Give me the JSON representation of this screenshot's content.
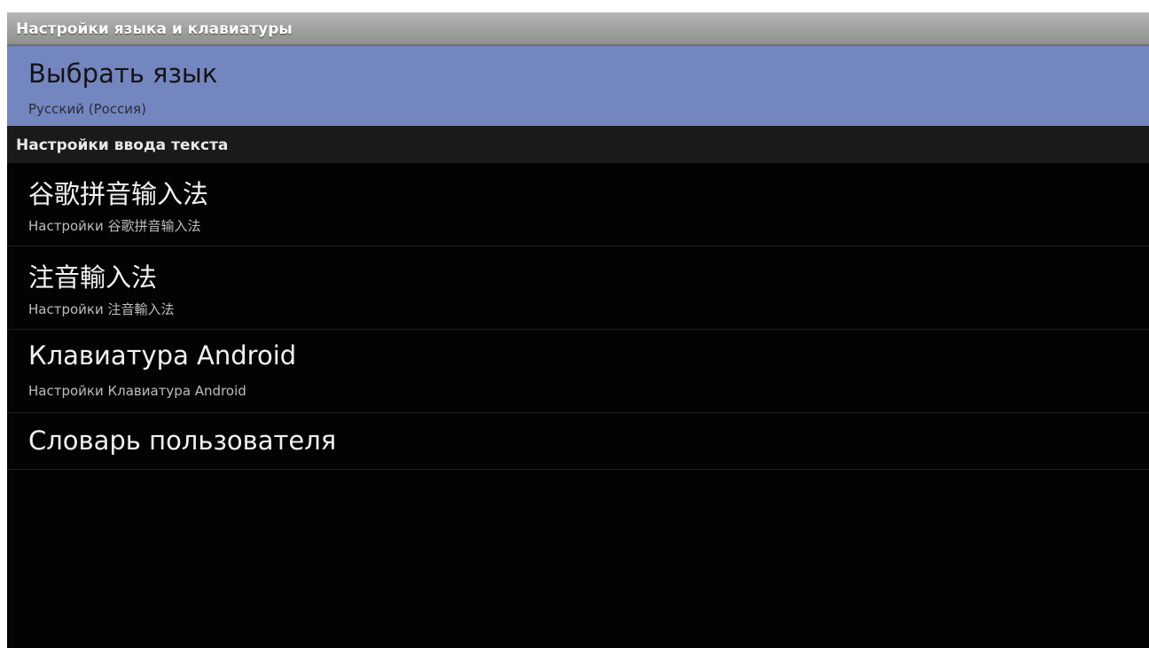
{
  "screen": {
    "title": "Настройки языка и клавиатуры"
  },
  "language": {
    "title": "Выбрать язык",
    "summary": "Русский (Россия)"
  },
  "input_category": {
    "label": "Настройки ввода текста"
  },
  "input_methods": [
    {
      "title": "谷歌拼音输入法",
      "summary": "Настройки 谷歌拼音输入法"
    },
    {
      "title": "注音輸入法",
      "summary": "Настройки 注音輸入法"
    },
    {
      "title": "Клавиатура Android",
      "summary": "Настройки Клавиатура Android"
    }
  ],
  "user_dictionary": {
    "title": "Словарь пользователя"
  },
  "colors": {
    "selected_background": "#7486bf",
    "titlebar": "#9fa19e",
    "background": "#030303"
  }
}
